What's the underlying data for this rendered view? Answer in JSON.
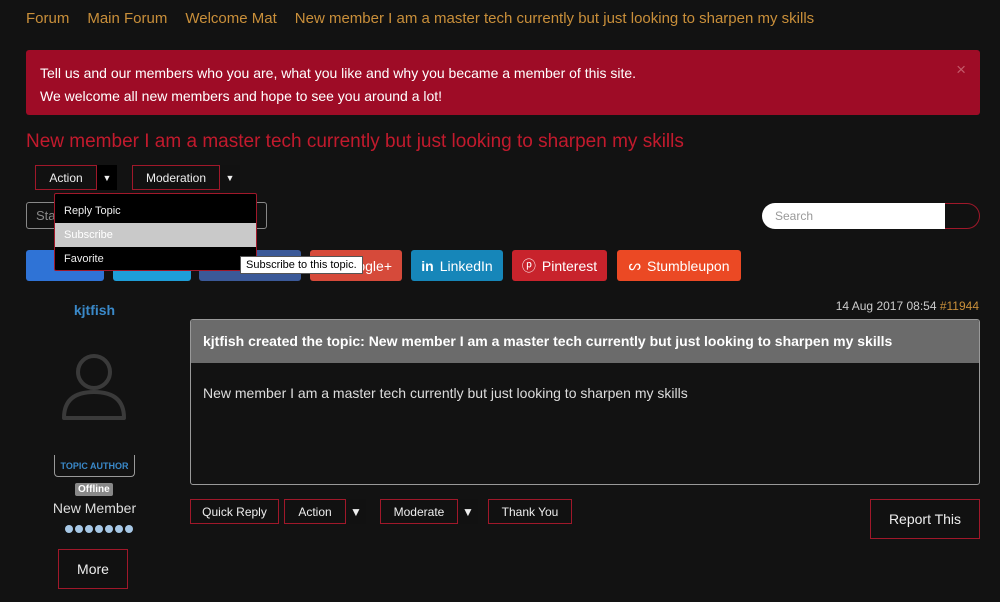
{
  "breadcrumb": [
    "Forum",
    "Main Forum",
    "Welcome Mat",
    "New member I am a master tech currently but just looking to sharpen my skills"
  ],
  "alert": {
    "line1": "Tell us and our members who you are, what you like and why you became a member of this site.",
    "line2": "We welcome all new members and hope to see you around a lot!",
    "close": "×"
  },
  "topic_title": "New member I am a master tech currently but just looking to sharpen my skills",
  "toolbar": {
    "action": "Action",
    "moderation": "Moderation",
    "start_placeholder": "Sta",
    "search_placeholder": "Search"
  },
  "dropdown": {
    "items": [
      "Reply Topic",
      "Subscribe",
      "Favorite"
    ],
    "tooltip": "Subscribe to this topic."
  },
  "share": {
    "google": "oogle+",
    "linkedin": "LinkedIn",
    "pinterest": "Pinterest",
    "stumbleupon": "Stumbleupon"
  },
  "post": {
    "date": "14 Aug 2017 08:54",
    "post_id": "#11944",
    "author": "kjtfish",
    "badge": "TOPIC AUTHOR",
    "status": "Offline",
    "rank": "New Member",
    "more": "More",
    "header": "kjtfish created the topic: New member I am a master tech currently but just looking to sharpen my skills",
    "body": "New member I am a master tech currently but just looking to sharpen my skills"
  },
  "post_actions": {
    "quick_reply": "Quick Reply",
    "action": "Action",
    "moderate": "Moderate",
    "thank_you": "Thank You",
    "report": "Report This"
  },
  "colors": {
    "accent_red": "#a0182a",
    "alert_bg": "#9e0c26",
    "link_gold": "#c98f3a",
    "user_blue": "#3a89c9"
  }
}
